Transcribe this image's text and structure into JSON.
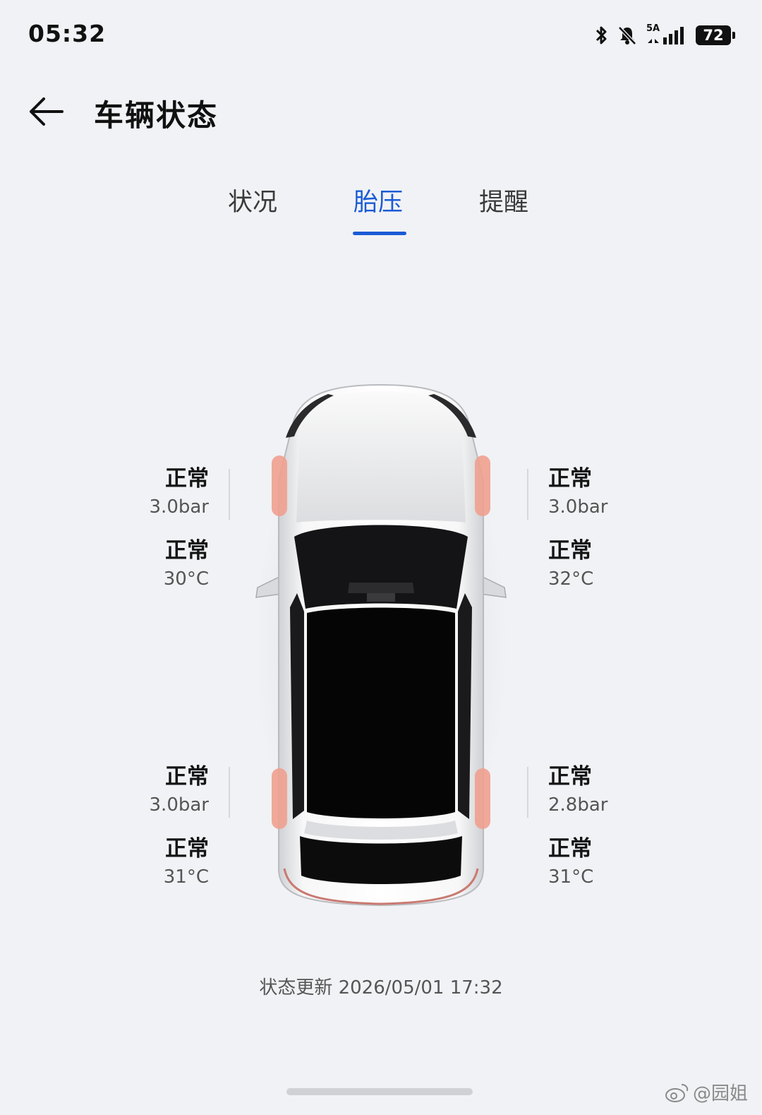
{
  "status_bar": {
    "time": "05:32",
    "network": "5A",
    "battery": "72",
    "icons": [
      "bluetooth-icon",
      "bell-muted-icon",
      "signal-icon",
      "battery-icon"
    ]
  },
  "header": {
    "title": "车辆状态",
    "back_icon": "arrow-left-icon"
  },
  "tabs": [
    {
      "label": "状况",
      "active": false
    },
    {
      "label": "胎压",
      "active": true
    },
    {
      "label": "提醒",
      "active": false
    }
  ],
  "tires": {
    "front_left": {
      "pressure_status": "正常",
      "pressure": "3.0bar",
      "temp_status": "正常",
      "temp": "30°C"
    },
    "front_right": {
      "pressure_status": "正常",
      "pressure": "3.0bar",
      "temp_status": "正常",
      "temp": "32°C"
    },
    "rear_left": {
      "pressure_status": "正常",
      "pressure": "3.0bar",
      "temp_status": "正常",
      "temp": "31°C"
    },
    "rear_right": {
      "pressure_status": "正常",
      "pressure": "2.8bar",
      "temp_status": "正常",
      "temp": "31°C"
    }
  },
  "update_text": "状态更新 2026/05/01 17:32",
  "watermark": "@园姐",
  "colors": {
    "accent": "#1a5bd6",
    "background": "#f1f2f5",
    "tire_highlight": "#f0a08f"
  }
}
